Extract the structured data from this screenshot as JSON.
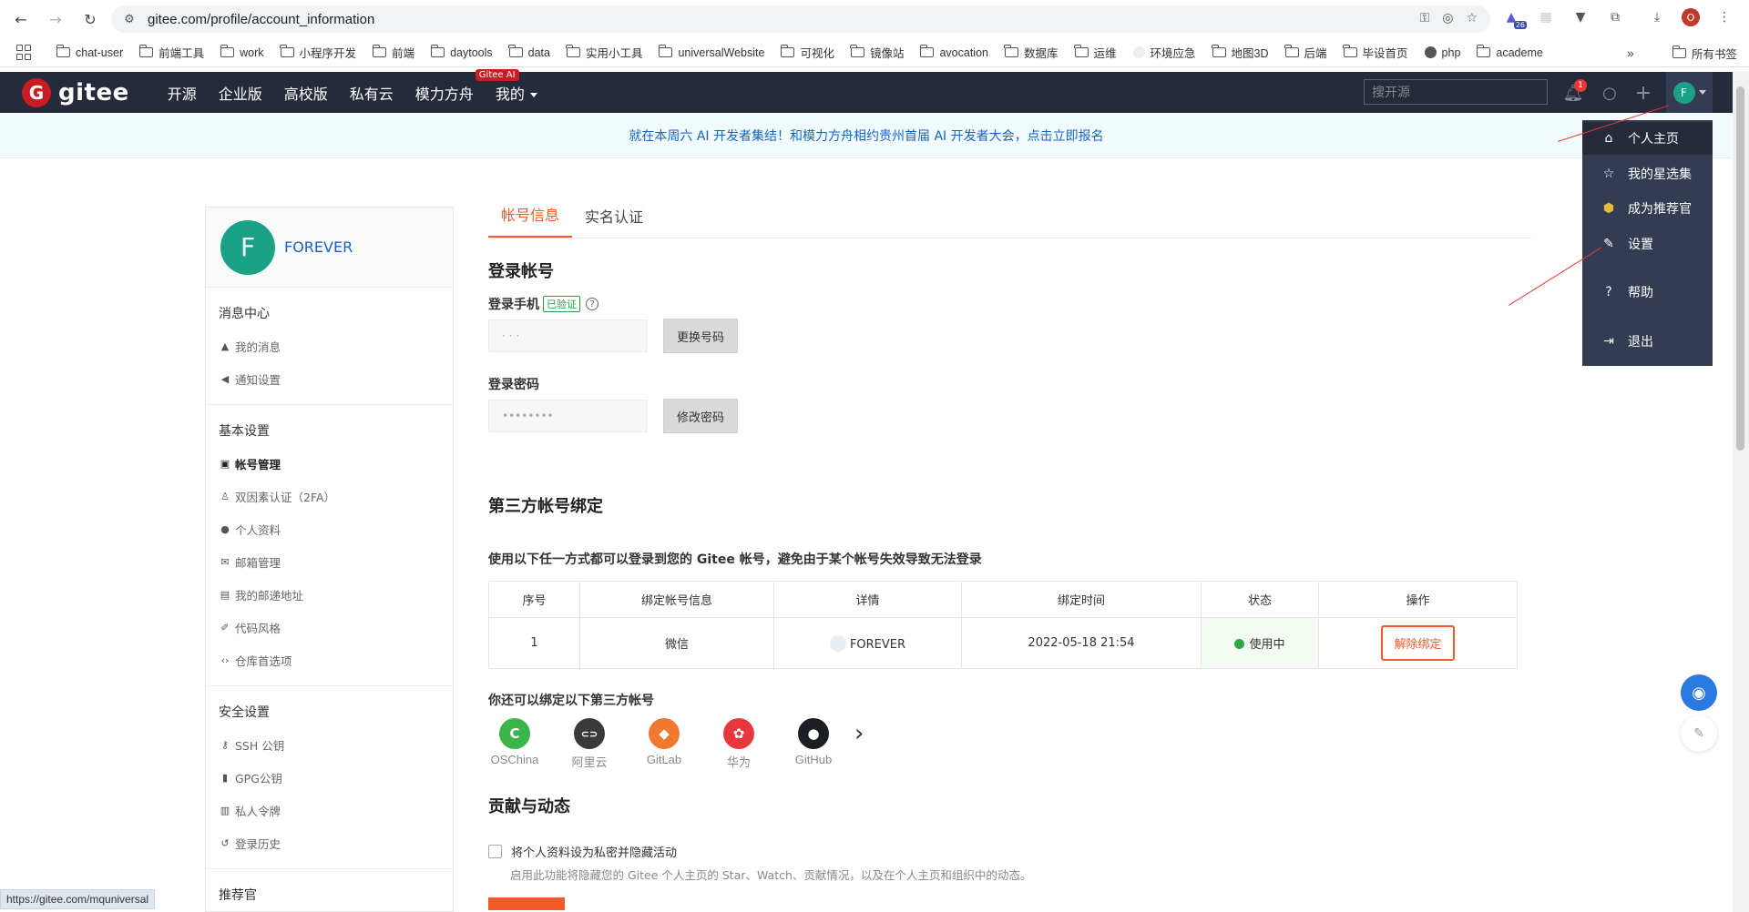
{
  "browser": {
    "url": "gitee.com/profile/account_information",
    "status_url": "https://gitee.com/mquniversal",
    "profile_initial": "O",
    "ext_badge": "26",
    "bookmarks": [
      "chat-user",
      "前端工具",
      "work",
      "小程序开发",
      "前端",
      "daytools",
      "data",
      "实用小工具",
      "universalWebsite",
      "可视化",
      "镜像站",
      "avocation",
      "数据库",
      "运维",
      "环境应急",
      "地图3D",
      "后端",
      "毕设首页",
      "php",
      "academe"
    ],
    "bookmarks_more": "»",
    "bookmarks_all": "所有书签"
  },
  "header": {
    "logo_text": "gitee",
    "logo_mark": "G",
    "nav": [
      "开源",
      "企业版",
      "高校版",
      "私有云",
      "模力方舟",
      "我的"
    ],
    "ai_badge": "Gitee AI",
    "search_placeholder": "搜开源",
    "bell_count": "1",
    "avatar_initial": "F"
  },
  "announcement": "就在本周六 AI 开发者集结！和模力方舟相约贵州首届 AI 开发者大会，点击立即报名",
  "dropdown": {
    "items": [
      {
        "label": "个人主页",
        "icon": "home-icon"
      },
      {
        "label": "我的星选集",
        "icon": "star-icon"
      },
      {
        "label": "成为推荐官",
        "icon": "badge-icon"
      },
      {
        "label": "设置",
        "icon": "edit-icon"
      },
      {
        "label": "帮助",
        "icon": "help-icon"
      },
      {
        "label": "退出",
        "icon": "logout-icon"
      }
    ]
  },
  "sidebar": {
    "avatar_initial": "F",
    "name": "FOREVER",
    "sections": [
      {
        "title": "消息中心",
        "items": [
          "我的消息",
          "通知设置"
        ]
      },
      {
        "title": "基本设置",
        "items": [
          "帐号管理",
          "双因素认证（2FA）",
          "个人资料",
          "邮箱管理",
          "我的邮递地址",
          "代码风格",
          "仓库首选项"
        ]
      },
      {
        "title": "安全设置",
        "items": [
          "SSH 公钥",
          "GPG公钥",
          "私人令牌",
          "登录历史"
        ]
      },
      {
        "title": "推荐官",
        "items": []
      }
    ]
  },
  "main": {
    "tabs": [
      "帐号信息",
      "实名认证"
    ],
    "login_title": "登录帐号",
    "phone_label": "登录手机",
    "verified": "已验证",
    "help_mark": "?",
    "phone_value": "· ·  ·",
    "change_phone": "更换号码",
    "password_label": "登录密码",
    "password_value": "••••••••",
    "change_password": "修改密码",
    "third_title": "第三方帐号绑定",
    "third_desc": "使用以下任一方式都可以登录到您的 Gitee 帐号，避免由于某个帐号失效导致无法登录",
    "table": {
      "headers": [
        "序号",
        "绑定帐号信息",
        "详情",
        "绑定时间",
        "状态",
        "操作"
      ],
      "rows": [
        {
          "index": "1",
          "type": "微信",
          "detail": "FOREVER",
          "time": "2022-05-18 21:54",
          "status": "使用中",
          "action": "解除绑定"
        }
      ]
    },
    "more_title": "你还可以绑定以下第三方帐号",
    "providers": [
      {
        "name": "OSChina",
        "color": "#3ab54a",
        "glyph": "C"
      },
      {
        "name": "阿里云",
        "color": "#3a3a3a",
        "glyph": "⊂⊃"
      },
      {
        "name": "GitLab",
        "color": "#f0782f",
        "glyph": "◆"
      },
      {
        "name": "华为",
        "color": "#e8383d",
        "glyph": "✿"
      },
      {
        "name": "GitHub",
        "color": "#1b1f23",
        "glyph": "●"
      }
    ],
    "providers_next": "›",
    "contrib_title": "贡献与动态",
    "private_label": "将个人资料设为私密并隐藏活动",
    "private_desc": "启用此功能将隐藏您的 Gitee 个人主页的 Star、Watch、贡献情况，以及在个人主页和组织中的动态。"
  },
  "colors": {
    "header_bg": "#252b3a",
    "accent": "#f05a28",
    "brand_red": "#c71d23",
    "link_blue": "#1565c0"
  }
}
